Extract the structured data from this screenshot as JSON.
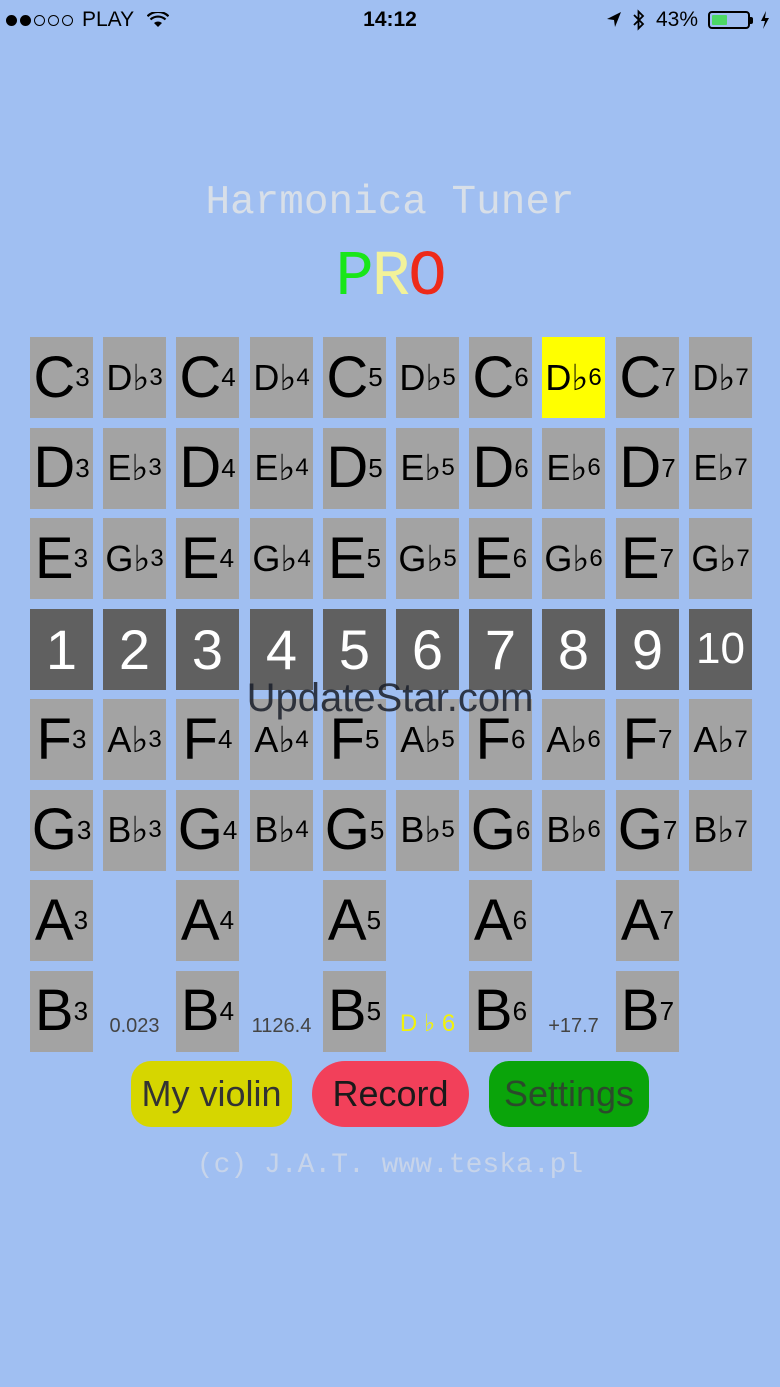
{
  "status_bar": {
    "carrier": "PLAY",
    "time": "14:12",
    "battery_percent": "43%",
    "battery_level": 0.43
  },
  "title": "Harmonica Tuner",
  "pro": [
    "P",
    "R",
    "O"
  ],
  "rows": [
    {
      "type": "notes",
      "cells": [
        [
          "C",
          "3"
        ],
        [
          "D♭",
          "3"
        ],
        [
          "C",
          "4"
        ],
        [
          "D♭",
          "4"
        ],
        [
          "C",
          "5"
        ],
        [
          "D♭",
          "5"
        ],
        [
          "C",
          "6"
        ],
        [
          "D♭",
          "6"
        ],
        [
          "C",
          "7"
        ],
        [
          "D♭",
          "7"
        ]
      ]
    },
    {
      "type": "notes",
      "cells": [
        [
          "D",
          "3"
        ],
        [
          "E♭",
          "3"
        ],
        [
          "D",
          "4"
        ],
        [
          "E♭",
          "4"
        ],
        [
          "D",
          "5"
        ],
        [
          "E♭",
          "5"
        ],
        [
          "D",
          "6"
        ],
        [
          "E♭",
          "6"
        ],
        [
          "D",
          "7"
        ],
        [
          "E♭",
          "7"
        ]
      ]
    },
    {
      "type": "notes",
      "cells": [
        [
          "E",
          "3"
        ],
        [
          "G♭",
          "3"
        ],
        [
          "E",
          "4"
        ],
        [
          "G♭",
          "4"
        ],
        [
          "E",
          "5"
        ],
        [
          "G♭",
          "5"
        ],
        [
          "E",
          "6"
        ],
        [
          "G♭",
          "6"
        ],
        [
          "E",
          "7"
        ],
        [
          "G♭",
          "7"
        ]
      ]
    },
    {
      "type": "holes",
      "cells": [
        "1",
        "2",
        "3",
        "4",
        "5",
        "6",
        "7",
        "8",
        "9",
        "10"
      ]
    },
    {
      "type": "notes",
      "cells": [
        [
          "F",
          "3"
        ],
        [
          "A♭",
          "3"
        ],
        [
          "F",
          "4"
        ],
        [
          "A♭",
          "4"
        ],
        [
          "F",
          "5"
        ],
        [
          "A♭",
          "5"
        ],
        [
          "F",
          "6"
        ],
        [
          "A♭",
          "6"
        ],
        [
          "F",
          "7"
        ],
        [
          "A♭",
          "7"
        ]
      ]
    },
    {
      "type": "notes",
      "cells": [
        [
          "G",
          "3"
        ],
        [
          "B♭",
          "3"
        ],
        [
          "G",
          "4"
        ],
        [
          "B♭",
          "4"
        ],
        [
          "G",
          "5"
        ],
        [
          "B♭",
          "5"
        ],
        [
          "G",
          "6"
        ],
        [
          "B♭",
          "6"
        ],
        [
          "G",
          "7"
        ],
        [
          "B♭",
          "7"
        ]
      ]
    },
    {
      "type": "notes",
      "cells": [
        [
          "A",
          "3"
        ],
        null,
        [
          "A",
          "4"
        ],
        null,
        [
          "A",
          "5"
        ],
        null,
        [
          "A",
          "6"
        ],
        null,
        [
          "A",
          "7"
        ],
        null
      ]
    },
    {
      "type": "notes",
      "cells": [
        [
          "B",
          "3"
        ],
        null,
        [
          "B",
          "4"
        ],
        null,
        [
          "B",
          "5"
        ],
        null,
        [
          "B",
          "6"
        ],
        null,
        [
          "B",
          "7"
        ],
        null
      ]
    }
  ],
  "active_note": "D♭6",
  "readouts": [
    "0.023",
    "1126.4",
    "D ♭ 6",
    "+17.7"
  ],
  "watermark": "UpdateStar.com",
  "buttons": {
    "violin": "My violin",
    "record": "Record",
    "settings": "Settings"
  },
  "copyright": "(c) J.A.T. www.teska.pl",
  "colors": {
    "background": "#a0bff2",
    "key": "#a3a3a3",
    "active_key": "#ffff00",
    "hole": "#606060"
  }
}
